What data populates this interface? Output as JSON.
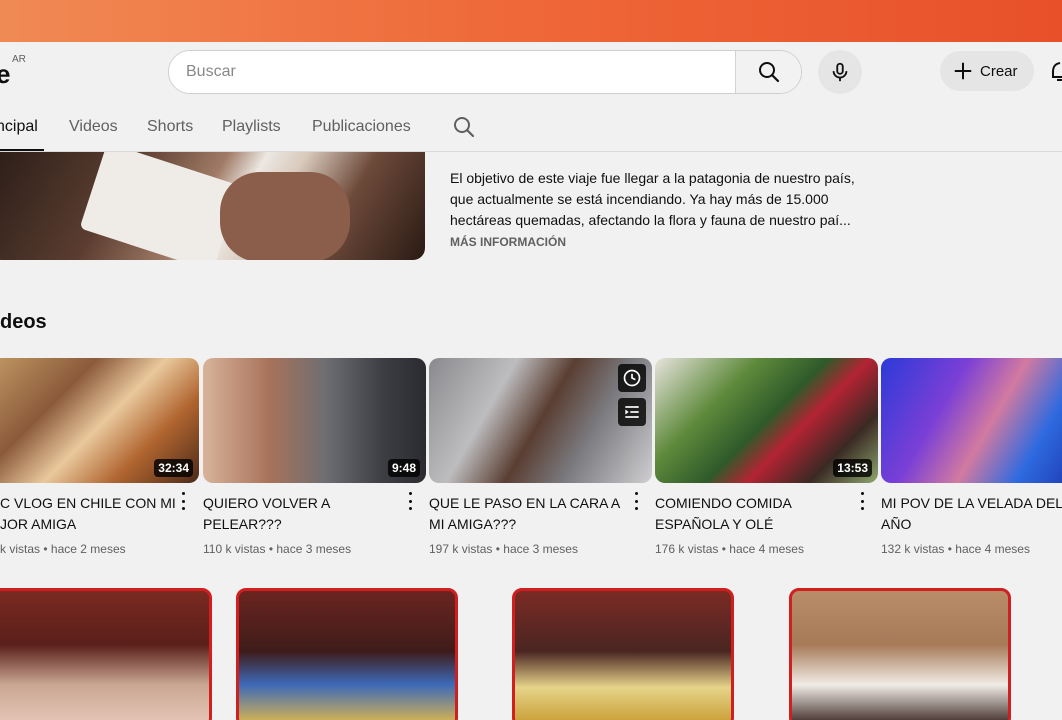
{
  "masthead": {
    "logo_fragment": "e",
    "country_code": "AR",
    "search_placeholder": "Buscar",
    "create_label": "Crear"
  },
  "tabs": [
    {
      "label": "ncipal",
      "active": true
    },
    {
      "label": "Videos",
      "active": false
    },
    {
      "label": "Shorts",
      "active": false
    },
    {
      "label": "Playlists",
      "active": false
    },
    {
      "label": "Publicaciones",
      "active": false
    }
  ],
  "featured": {
    "description": "El objetivo de este viaje fue llegar a la patagonia de nuestro país, que actualmente se está incendiando. Ya hay más de 15.000 hectáreas quemadas, afectando la flora y fauna de nuestro paí...",
    "more_label": "MÁS INFORMACIÓN"
  },
  "videos_section": {
    "title": "deos",
    "items": [
      {
        "title": "C VLOG EN CHILE CON MI JOR AMIGA",
        "duration": "32:34",
        "views": "k vistas",
        "age": "hace 2 meses"
      },
      {
        "title": "QUIERO VOLVER A PELEAR???",
        "duration": "9:48",
        "views": "110 k vistas",
        "age": "hace 3 meses"
      },
      {
        "title": "QUE LE PASO EN LA CARA A MI AMIGA???",
        "duration": "",
        "views": "197 k vistas",
        "age": "hace 3 meses"
      },
      {
        "title": "COMIENDO COMIDA ESPAÑOLA Y OLÉ",
        "duration": "13:53",
        "views": "176 k vistas",
        "age": "hace 4 meses"
      },
      {
        "title": "MI POV DE LA VELADA DEL AÑO",
        "duration": "",
        "views": "132 k vistas",
        "age": "hace 4 meses"
      }
    ]
  },
  "meta_separator": "•",
  "icons": {
    "search": "search-icon",
    "mic": "mic-icon",
    "create": "plus-icon",
    "notifications": "bell-icon",
    "watch_later": "clock-icon",
    "add_to_queue": "queue-icon",
    "more": "kebab-icon"
  },
  "colors": {
    "top_band": "#ef6a3a",
    "podcast_border": "#d11f1f",
    "page_bg": "#f1f1f1"
  }
}
